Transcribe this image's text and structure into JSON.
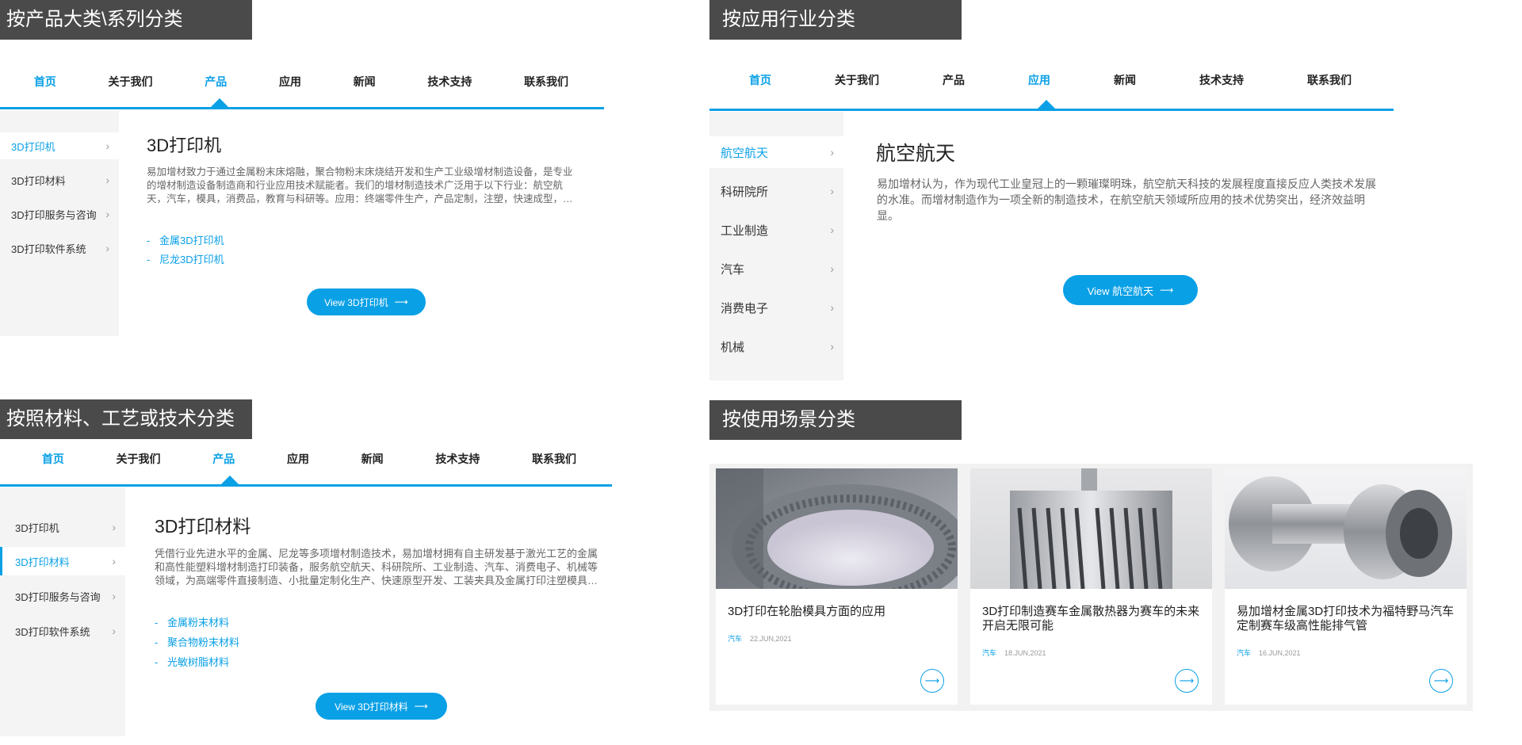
{
  "sections": {
    "product": "按产品大类\\系列分类",
    "industry": "按应用行业分类",
    "material": "按照材料、工艺或技术分类",
    "scenario": "按使用场景分类"
  },
  "nav": [
    "首页",
    "关于我们",
    "产品",
    "应用",
    "新闻",
    "技术支持",
    "联系我们"
  ],
  "panel1": {
    "sidebar": [
      "3D打印机",
      "3D打印材料",
      "3D打印服务与咨询",
      "3D打印软件系统"
    ],
    "title": "3D打印机",
    "desc": "易加增材致力于通过金属粉末床熔融，聚合物粉末床烧结开发和生产工业级增材制造设备，是专业的增材制造设备制造商和行业应用技术赋能者。我们的增材制造技术广泛用于以下行业：航空航天，汽车，模具，消费品，教育与科研等。应用：终端零件生产，产品定制，注塑，快速成型，…",
    "links": [
      "金属3D打印机",
      "尼龙3D打印机"
    ],
    "button": "View 3D打印机"
  },
  "panel2": {
    "sidebar": [
      "航空航天",
      "科研院所",
      "工业制造",
      "汽车",
      "消费电子",
      "机械"
    ],
    "title": "航空航天",
    "desc": "易加增材认为，作为现代工业皇冠上的一颗璀璨明珠，航空航天科技的发展程度直接反应人类技术发展的水准。而增材制造作为一项全新的制造技术，在航空航天领域所应用的技术优势突出，经济效益明显。",
    "button": "View 航空航天"
  },
  "panel3": {
    "sidebar": [
      "3D打印机",
      "3D打印材料",
      "3D打印服务与咨询",
      "3D打印软件系统"
    ],
    "title": "3D打印材料",
    "desc": "凭借行业先进水平的金属、尼龙等多项增材制造技术，易加增材拥有自主研发基于激光工艺的金属和高性能塑料增材制造打印装备，服务航空航天、科研院所、工业制造、汽车、消费电子、机械等领域，为高端零件直接制造、小批量定制化生产、快速原型开发、工装夹具及金属打印注塑模具…",
    "links": [
      "金属粉末材料",
      "聚合物粉末材料",
      "光敏树脂材料"
    ],
    "button": "View 3D打印材料"
  },
  "cards": [
    {
      "title": "3D打印在轮胎模具方面的应用",
      "category": "汽车",
      "date": "22.JUN,2021"
    },
    {
      "title": "3D打印制造赛车金属散热器为赛车的未来开启无限可能",
      "category": "汽车",
      "date": "18.JUN,2021"
    },
    {
      "title": "易加增材金属3D打印技术为福特野马汽车定制赛车级高性能排气管",
      "category": "汽车",
      "date": "16.JUN,2021"
    }
  ],
  "icons": {
    "chevron": "chevron-right-icon",
    "arrow": "arrow-right-icon",
    "circle_arrow": "circle-arrow-icon"
  },
  "colors": {
    "accent": "#0aa0e6",
    "title_bar": "#4a4a4a",
    "sidebar_bg": "#f4f4f4"
  },
  "glyphs": {
    "chevron": "›",
    "arrow": "⟶",
    "dash": "-"
  }
}
